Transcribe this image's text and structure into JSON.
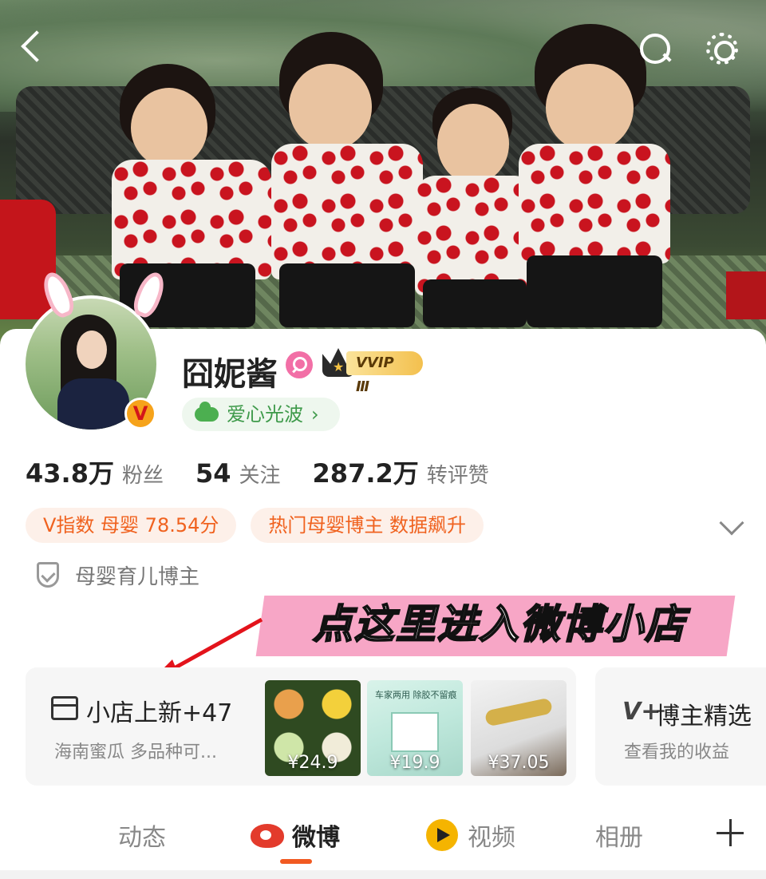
{
  "profile": {
    "name": "囧妮酱",
    "vip_label": "VVIP Ⅲ",
    "love_wave": "爱心光波",
    "love_chevron": "›"
  },
  "stats": [
    {
      "value": "43.8万",
      "label": "粉丝"
    },
    {
      "value": "54",
      "label": "关注"
    },
    {
      "value": "287.2万",
      "label": "转评赞"
    }
  ],
  "tags": [
    "V指数 母婴 78.54分",
    "热门母婴博主 数据飙升"
  ],
  "category": "母婴育儿博主",
  "annotation": "点这里进入微博小店",
  "shop": {
    "title": "小店上新+47",
    "subtitle": "海南蜜瓜 多品种可...",
    "products": [
      {
        "price": "¥24.9"
      },
      {
        "price": "¥19.9",
        "caption": "车家两用 除胶不留痕"
      },
      {
        "price": "¥37.05"
      }
    ]
  },
  "picks": {
    "icon": "V+",
    "title": "博主精选",
    "subtitle": "查看我的收益"
  },
  "tabs": {
    "dynamic": "动态",
    "weibo": "微博",
    "video": "视频",
    "album": "相册"
  },
  "colors": {
    "accent": "#f15a22",
    "tag_text": "#f0621f",
    "tag_bg": "#fdf0e9",
    "love_green": "#3e9a4a",
    "annotation_bg": "#f7a6c6",
    "arrow": "#e3131b"
  },
  "icons": [
    "back-icon",
    "search-icon",
    "settings-icon",
    "gender-female-icon",
    "crown-icon",
    "cloud-icon",
    "verified-v-icon",
    "shield-icon",
    "expand-icon",
    "shop-icon",
    "weibo-icon",
    "video-icon",
    "plus-icon"
  ]
}
